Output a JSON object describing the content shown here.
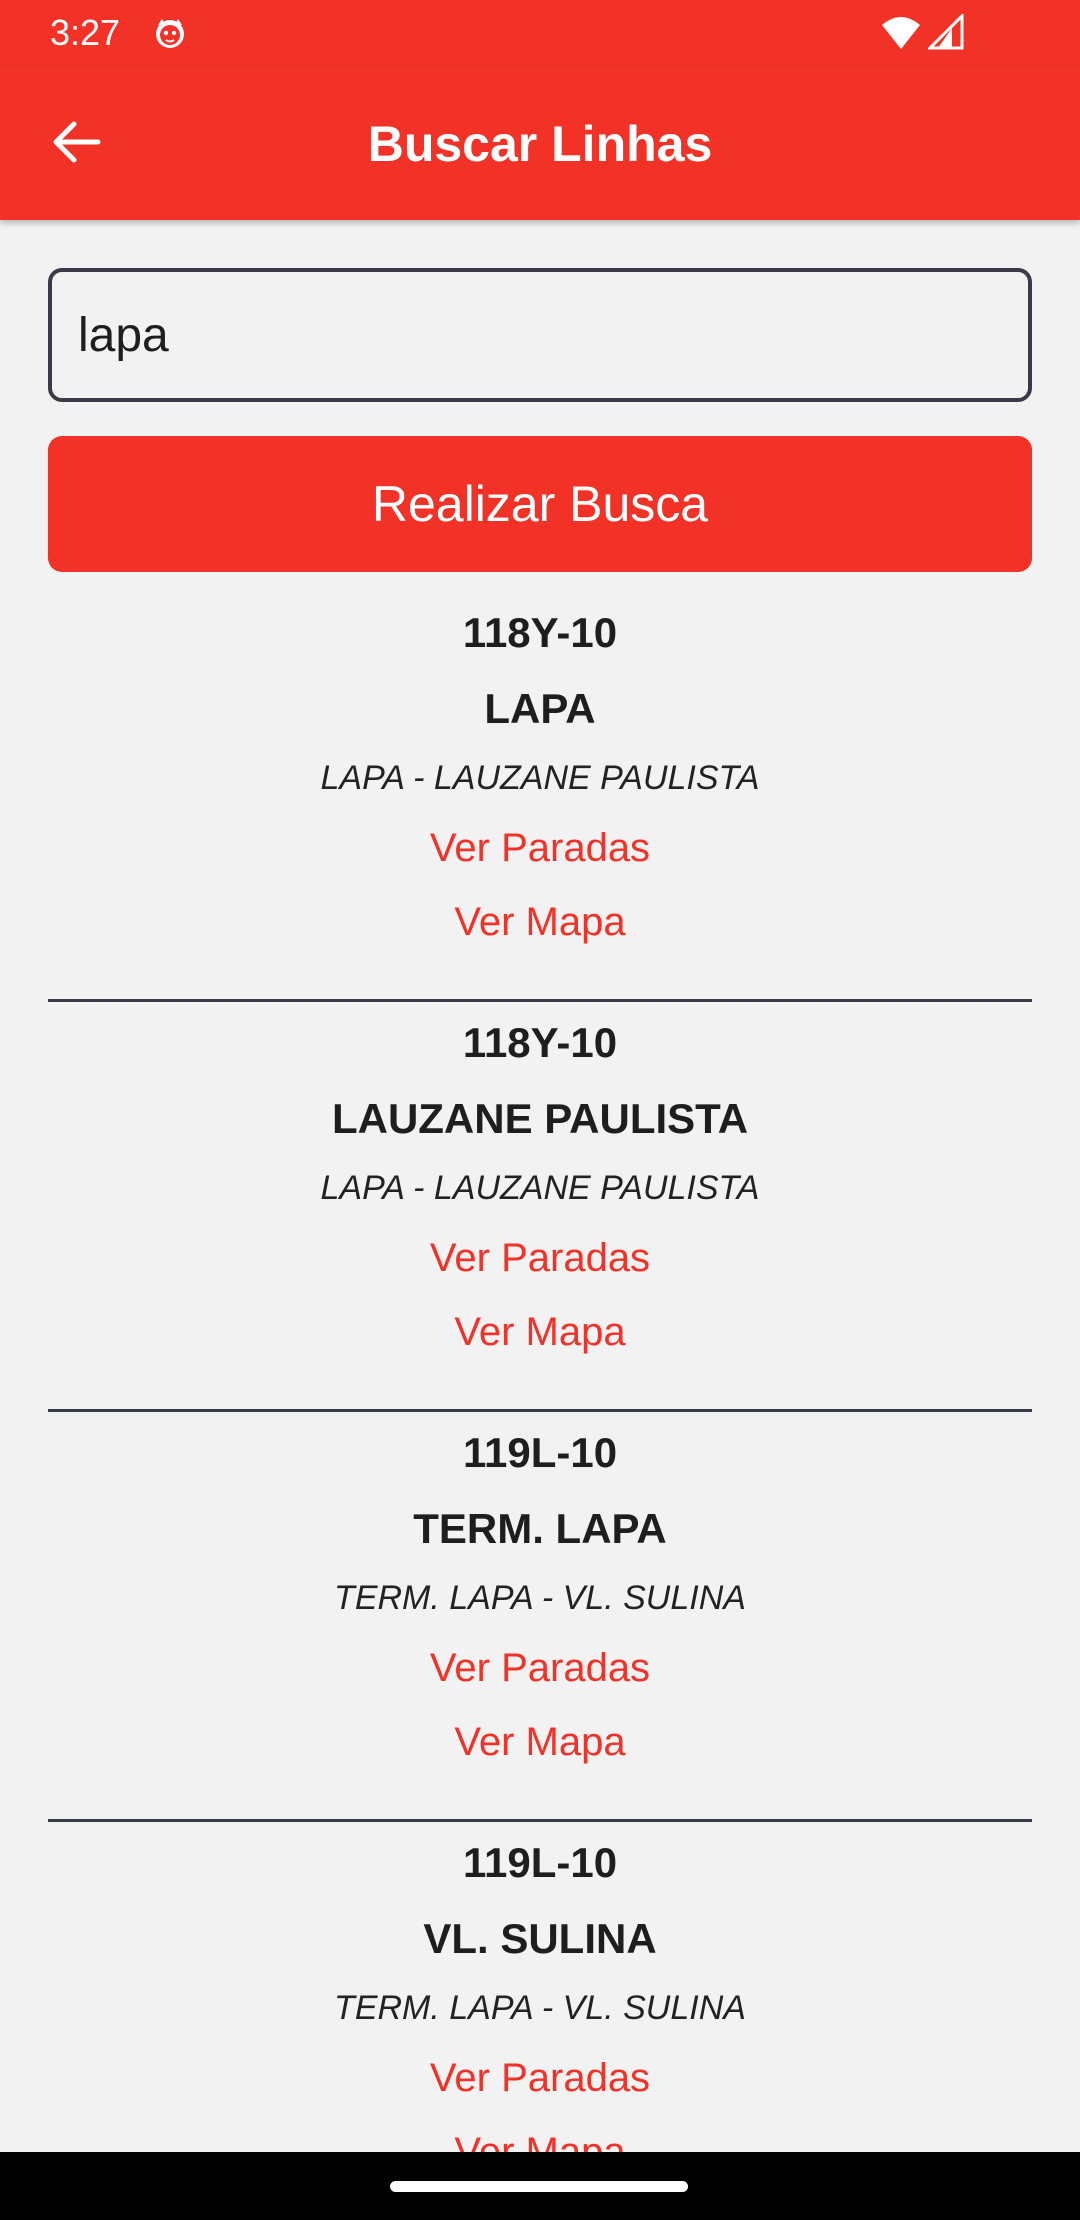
{
  "status_bar": {
    "time": "3:27"
  },
  "app_bar": {
    "title": "Buscar Linhas"
  },
  "search": {
    "value": "lapa",
    "button_label": "Realizar Busca"
  },
  "results": [
    {
      "code": "118Y-10",
      "destination": "LAPA",
      "route": "LAPA - LAUZANE PAULISTA",
      "stops_link": "Ver Paradas",
      "map_link": "Ver Mapa"
    },
    {
      "code": "118Y-10",
      "destination": "LAUZANE PAULISTA",
      "route": "LAPA - LAUZANE PAULISTA",
      "stops_link": "Ver Paradas",
      "map_link": "Ver Mapa"
    },
    {
      "code": "119L-10",
      "destination": "TERM. LAPA",
      "route": "TERM. LAPA - VL. SULINA",
      "stops_link": "Ver Paradas",
      "map_link": "Ver Mapa"
    },
    {
      "code": "119L-10",
      "destination": "VL. SULINA",
      "route": "TERM. LAPA - VL. SULINA",
      "stops_link": "Ver Paradas",
      "map_link": "Ver Mapa"
    }
  ],
  "colors": {
    "accent": "#f23127",
    "background": "#f2f2f2",
    "border": "#3a3a48"
  }
}
